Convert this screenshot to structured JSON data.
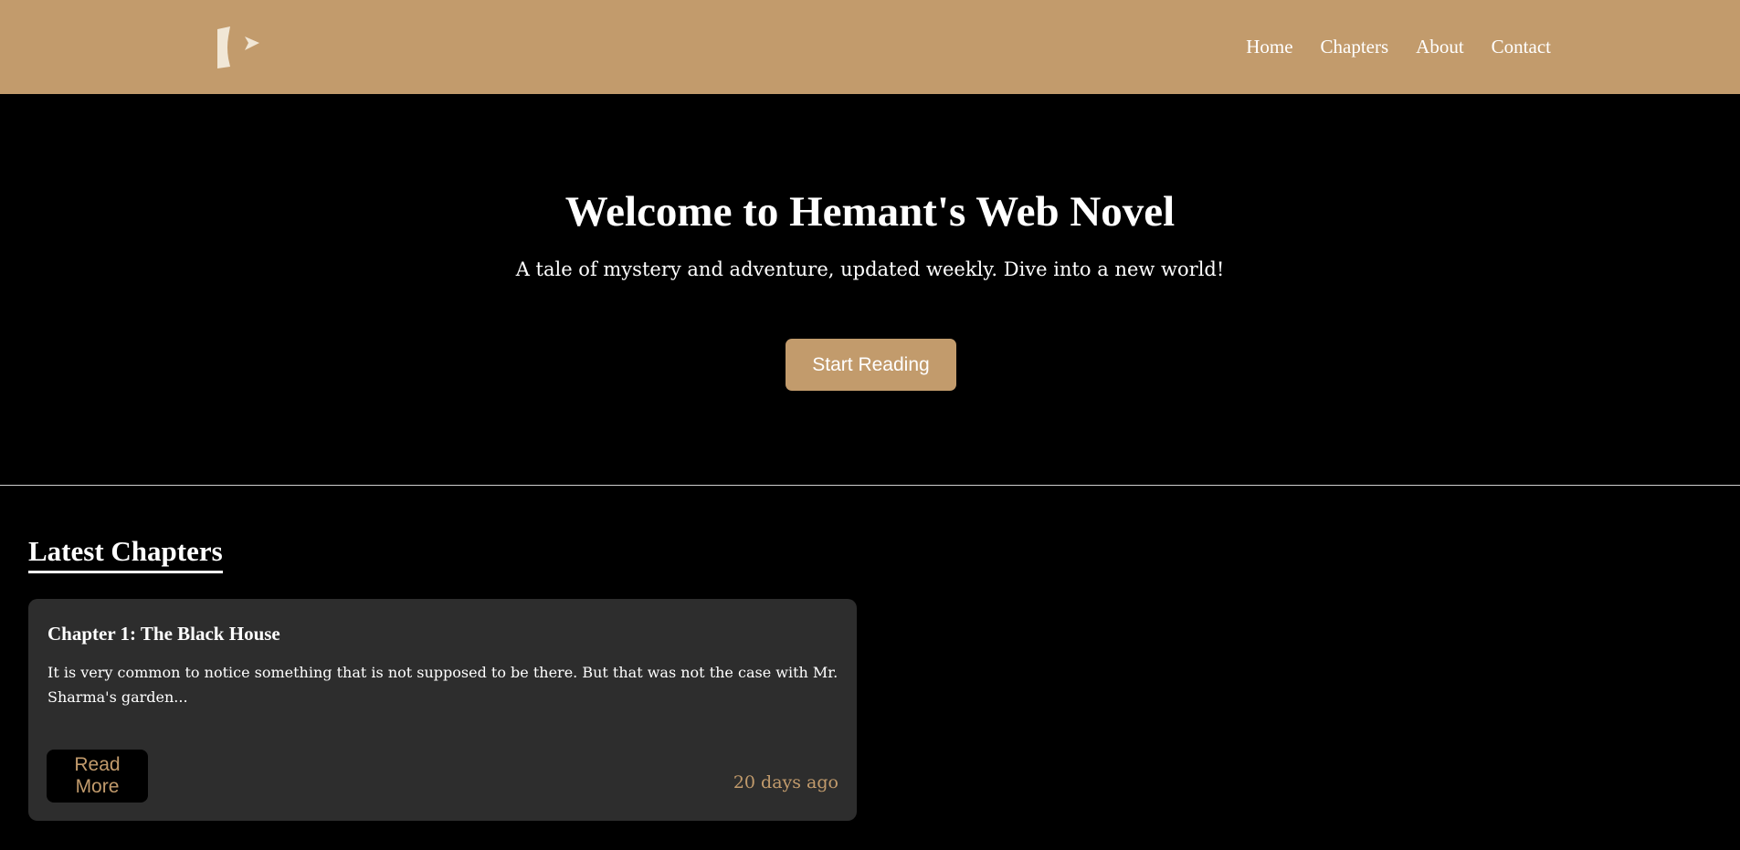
{
  "header": {
    "logo_icon": "bookmark-play-logo",
    "nav": [
      "Home",
      "Chapters",
      "About",
      "Contact"
    ]
  },
  "hero": {
    "title": "Welcome to Hemant's Web Novel",
    "subtitle": "A tale of mystery and adventure, updated weekly. Dive into a new world!",
    "cta_label": "Start Reading"
  },
  "latest": {
    "heading": "Latest Chapters",
    "chapters": [
      {
        "title": "Chapter 1: The Black House",
        "excerpt": "It is very common to notice something that is not supposed to be there. But that was not the case with Mr. Sharma's garden...",
        "read_more_label": "Read More",
        "date": "20 days ago"
      }
    ]
  },
  "colors": {
    "accent": "#c29b6c",
    "background": "#000000",
    "card": "#2d2d2d",
    "text": "#ffffff"
  }
}
